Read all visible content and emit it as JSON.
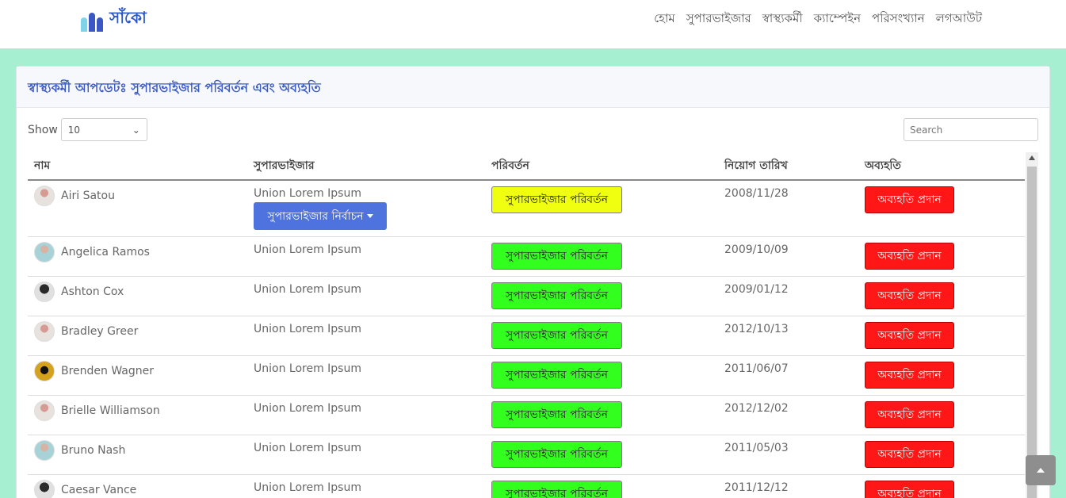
{
  "brand": {
    "name": "সাঁকো"
  },
  "nav": [
    "হোম",
    "সুপারভাইজার",
    "স্বাস্থ্যকর্মী",
    "ক্যাম্পেইন",
    "পরিসংখ্যান",
    "লগআউট"
  ],
  "card": {
    "title": "স্বাস্থ্যকর্মী আপডেটঃ সুপারভাইজার পরিবর্তন এবং অব্যহতি"
  },
  "controls": {
    "show_label": "Show",
    "page_size": "10",
    "search_placeholder": "Search"
  },
  "table": {
    "headers": [
      "নাম",
      "সুপারভাইজার",
      "পরিবর্তন",
      "নিয়োগ তারিখ",
      "অব্যহতি"
    ],
    "rows": [
      {
        "name": "Airi Satou",
        "supervisor": "Union Lorem Ipsum",
        "date": "2008/11/28"
      },
      {
        "name": "Angelica Ramos",
        "supervisor": "Union Lorem Ipsum",
        "date": "2009/10/09"
      },
      {
        "name": "Ashton Cox",
        "supervisor": "Union Lorem Ipsum",
        "date": "2009/01/12"
      },
      {
        "name": "Bradley Greer",
        "supervisor": "Union Lorem Ipsum",
        "date": "2012/10/13"
      },
      {
        "name": "Brenden Wagner",
        "supervisor": "Union Lorem Ipsum",
        "date": "2011/06/07"
      },
      {
        "name": "Brielle Williamson",
        "supervisor": "Union Lorem Ipsum",
        "date": "2012/12/02"
      },
      {
        "name": "Bruno Nash",
        "supervisor": "Union Lorem Ipsum",
        "date": "2011/05/03"
      },
      {
        "name": "Caesar Vance",
        "supervisor": "Union Lorem Ipsum",
        "date": "2011/12/12"
      }
    ],
    "change_label": "সুপারভাইজার পরিবর্তন",
    "leave_label": "অব্যহতি প্রদান",
    "select_label": "সুপারভাইজার নির্বাচন"
  }
}
